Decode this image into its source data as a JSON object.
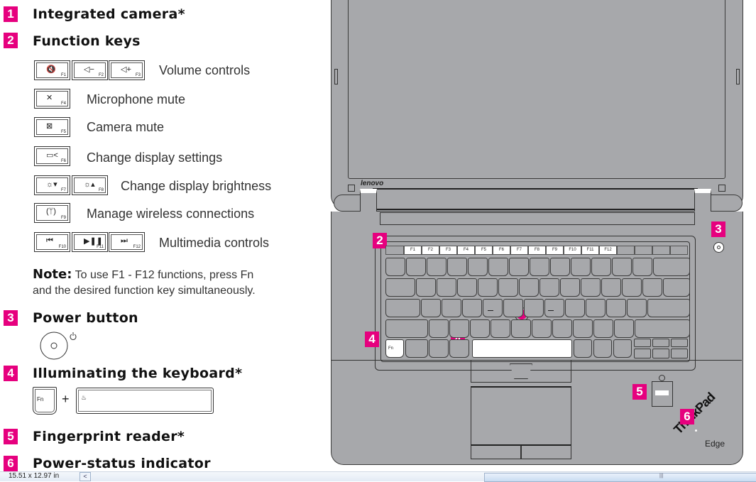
{
  "colors": {
    "accent": "#e6007e",
    "laptop_body": "#a7a8ab"
  },
  "sections": [
    {
      "number": "1",
      "title": "Integrated camera*"
    },
    {
      "number": "2",
      "title": "Function keys"
    },
    {
      "number": "3",
      "title": "Power button"
    },
    {
      "number": "4",
      "title": "Illuminating the keyboard*"
    },
    {
      "number": "5",
      "title": "Fingerprint reader*"
    },
    {
      "number": "6",
      "title": "Power-status indicator"
    }
  ],
  "function_keys": [
    {
      "description": "Volume controls",
      "keys": [
        {
          "icon": "speaker-mute-icon",
          "glyph": "🔇",
          "label": "F1"
        },
        {
          "icon": "volume-down-icon",
          "glyph": "◁−",
          "label": "F2"
        },
        {
          "icon": "volume-up-icon",
          "glyph": "◁+",
          "label": "F3"
        }
      ]
    },
    {
      "description": "Microphone mute",
      "keys": [
        {
          "icon": "microphone-mute-icon",
          "glyph": "✕",
          "label": "F4"
        }
      ]
    },
    {
      "description": "Camera mute",
      "keys": [
        {
          "icon": "camera-mute-icon",
          "glyph": "⊠",
          "label": "F5"
        }
      ]
    },
    {
      "description": "Change display settings",
      "keys": [
        {
          "icon": "display-icon",
          "glyph": "▭<",
          "label": "F6"
        }
      ]
    },
    {
      "description": "Change display brightness",
      "keys": [
        {
          "icon": "brightness-down-icon",
          "glyph": "☼▾",
          "label": "F7"
        },
        {
          "icon": "brightness-up-icon",
          "glyph": "☼▴",
          "label": "F8"
        }
      ]
    },
    {
      "description": "Manage wireless connections",
      "keys": [
        {
          "icon": "wireless-icon",
          "glyph": "(ᛘ)",
          "label": "F9"
        }
      ]
    },
    {
      "description": "Multimedia controls",
      "keys": [
        {
          "icon": "previous-track-icon",
          "glyph": "⏮",
          "label": "F10"
        },
        {
          "icon": "play-pause-icon",
          "glyph": "▶❚❚",
          "label": "F11"
        },
        {
          "icon": "next-track-icon",
          "glyph": "⏭",
          "label": "F12"
        }
      ]
    }
  ],
  "note": {
    "label": "Note:",
    "text_line1": "To use F1 - F12 functions, press Fn",
    "text_line2": "and the desired function key simultaneously."
  },
  "illumination": {
    "fn_label": "Fn",
    "plus": "+",
    "space_glyph": "♨"
  },
  "laptop": {
    "brand": "lenovo",
    "logo_line1": "ThinkPad",
    "logo_line2": "Edge",
    "callouts": [
      "2",
      "3",
      "4",
      "4",
      "5",
      "6"
    ],
    "fn_key_label": "Fn",
    "fkeys": [
      "F1",
      "F2",
      "F3",
      "F4",
      "F5",
      "F6",
      "F7",
      "F8",
      "F9",
      "F10",
      "F11",
      "F12"
    ]
  },
  "statusbar": {
    "page_size": "15.51 x 12.97 in",
    "scroll_left": "<",
    "scroll_grip": "|||"
  }
}
